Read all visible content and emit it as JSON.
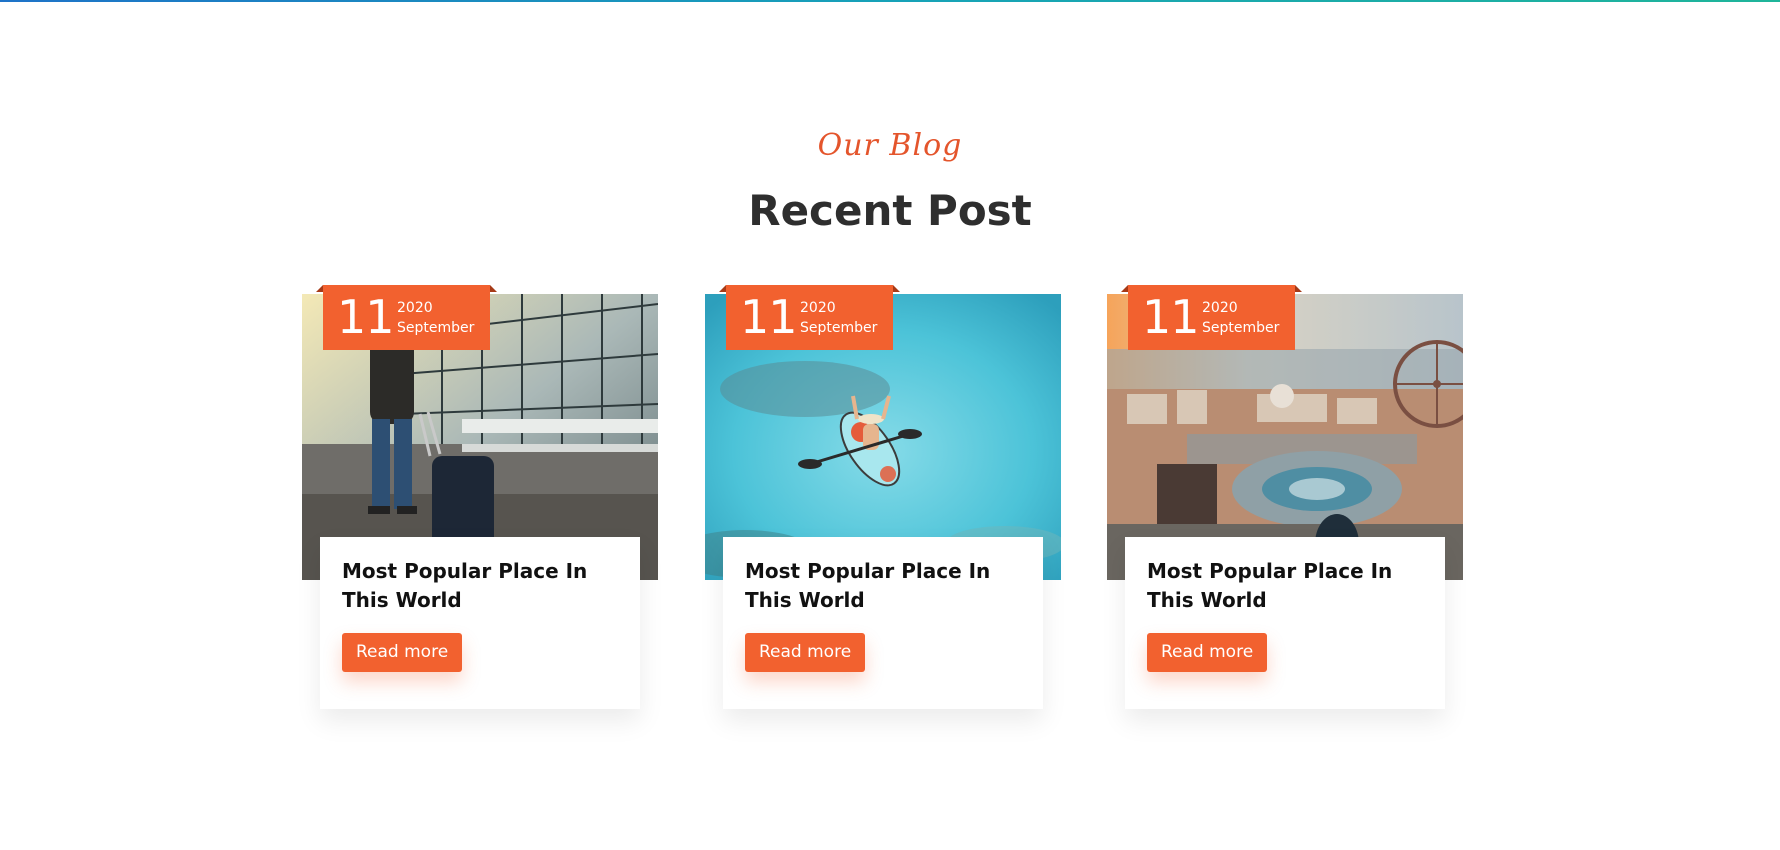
{
  "section": {
    "kicker": "Our Blog",
    "title": "Recent Post"
  },
  "posts": [
    {
      "image": "traveler walking with suitcase at station",
      "day": "11",
      "year": "2020",
      "month": "September",
      "title": "Most Popular Place In This World",
      "button": "Read more"
    },
    {
      "image": "kayaker on turquoise water",
      "day": "11",
      "year": "2020",
      "month": "September",
      "title": "Most Popular Place In This World",
      "button": "Read more"
    },
    {
      "image": "city plaza with ferris wheel",
      "day": "11",
      "year": "2020",
      "month": "September",
      "title": "Most Popular Place In This World",
      "button": "Read more"
    }
  ],
  "colors": {
    "accent": "#f2612f",
    "heading": "#2e2e2e",
    "kicker": "#e4552c"
  }
}
